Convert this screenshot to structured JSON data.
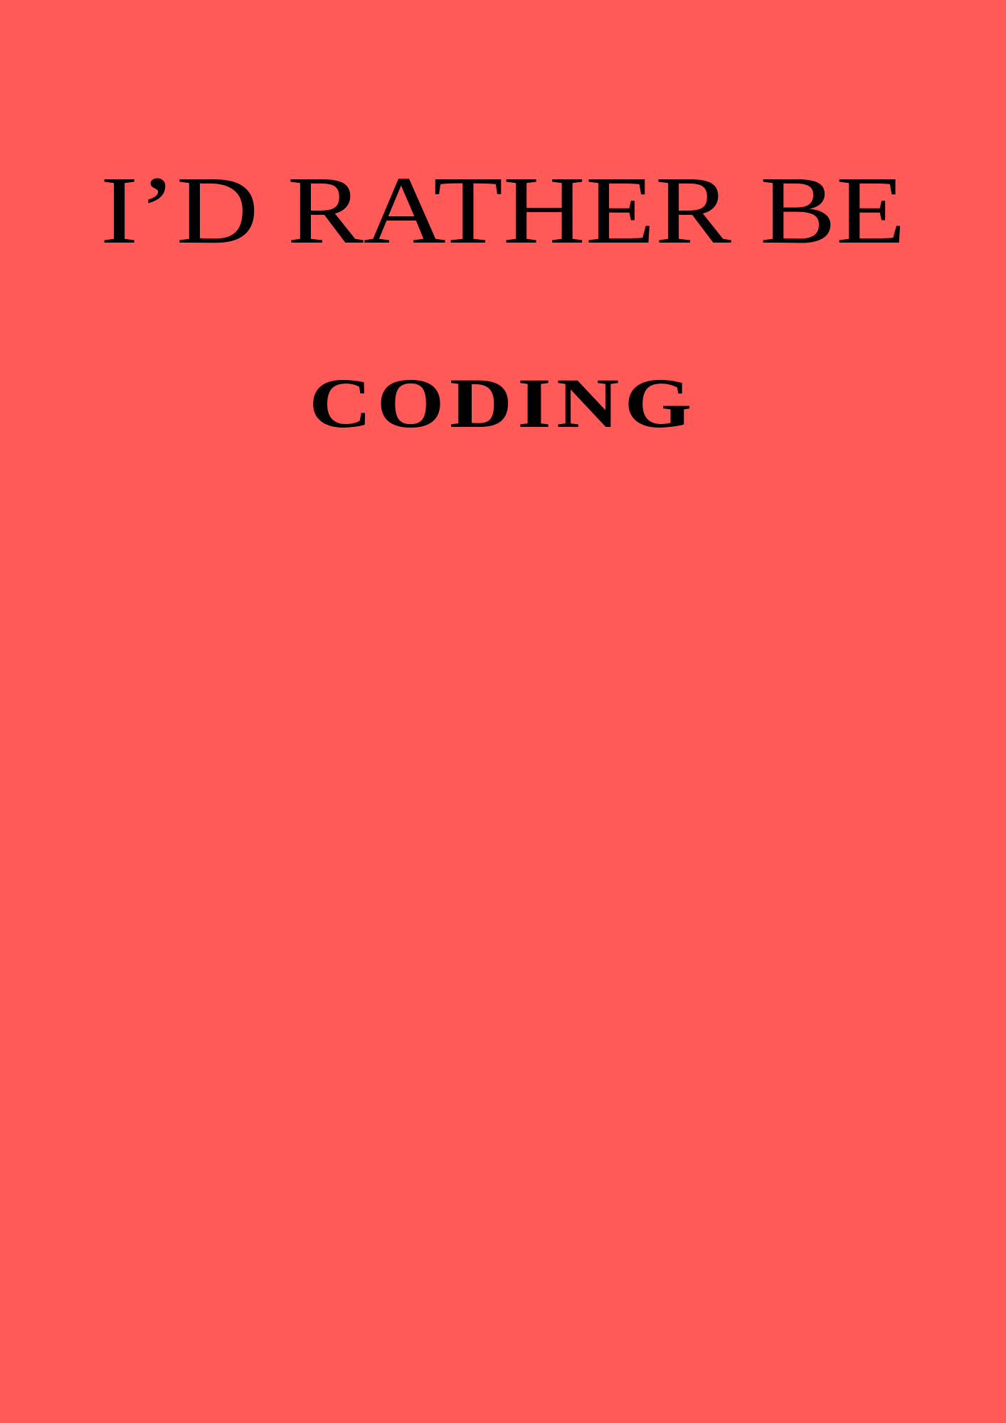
{
  "poster": {
    "headline": "I’D RATHER BE",
    "subline": "CODING",
    "background_color": "#ff5a57",
    "text_color": "#000000"
  }
}
